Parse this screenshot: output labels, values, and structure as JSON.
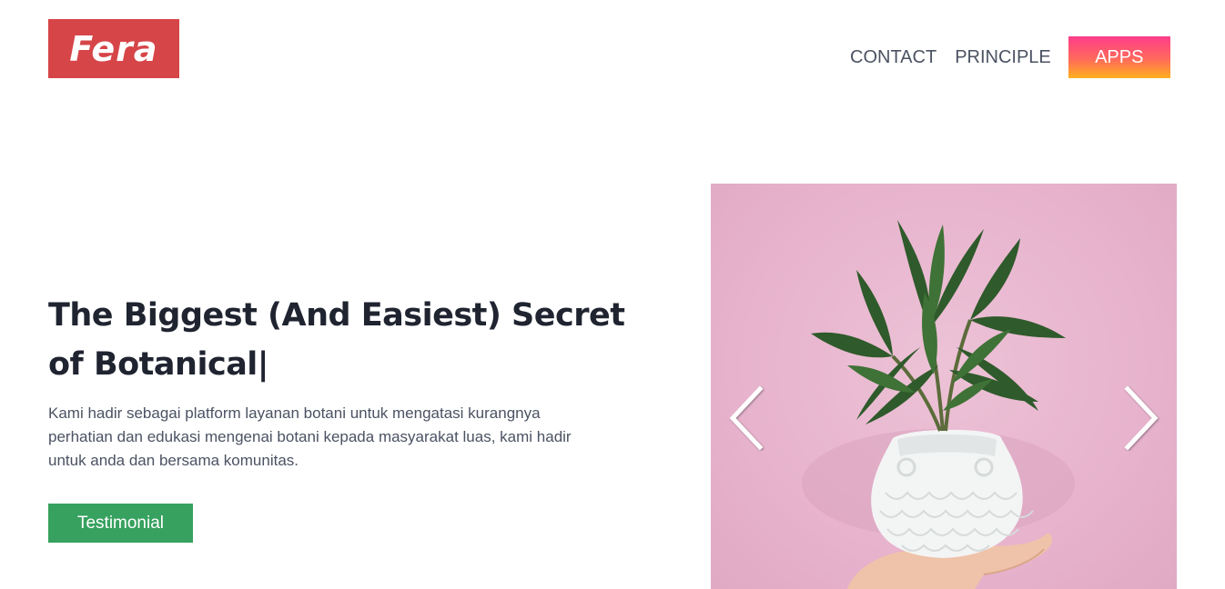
{
  "header": {
    "logo_text": "Fera",
    "nav": [
      {
        "label": "CONTACT"
      },
      {
        "label": "PRINCIPLE"
      },
      {
        "label": "APPS"
      }
    ]
  },
  "hero": {
    "title": "The Biggest (And Easiest) Secret of Botanical|",
    "description": "Kami hadir sebagai platform layanan botani untuk mengatasi kurangnya perhatian dan edukasi mengenai botani kepada masyarakat luas, kami hadir untuk anda dan bersama komunitas.",
    "cta_label": "Testimonial"
  },
  "carousel": {
    "image_subject": "potted plant in white owl vase held by hand",
    "prev_icon": "chevron-left-icon",
    "next_icon": "chevron-right-icon"
  },
  "colors": {
    "logo_bg": "#d64548",
    "cta_bg": "#37a15f",
    "apps_gradient_top": "#ff3d8b",
    "apps_gradient_bottom": "#ffb11f",
    "carousel_bg": "#e7b3cd",
    "nav_text": "#4b5262",
    "title_text": "#1f2430"
  }
}
